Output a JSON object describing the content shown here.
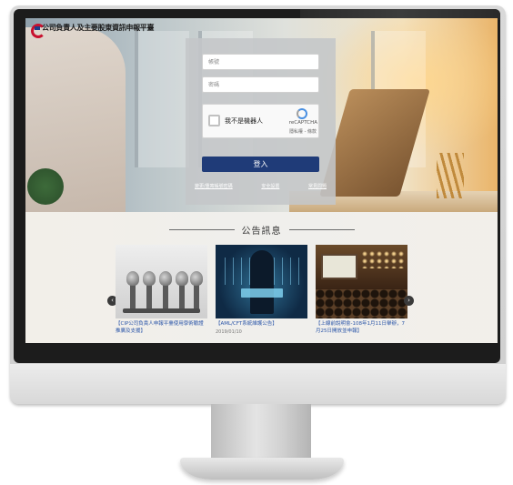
{
  "header": {
    "site_title": "公司負責人及主要股東資訊申報平臺"
  },
  "login": {
    "account_placeholder": "帳號",
    "password_placeholder": "密碼",
    "captcha_label": "我不是機器人",
    "captcha_brand": "reCAPTCHA",
    "captcha_links": "隱私權 - 條款",
    "login_button": "登入",
    "links": [
      "變更/重寄帳號密碼",
      "安全設置",
      "常見問題"
    ]
  },
  "announcements": {
    "title": "公告訊息",
    "items": [
      {
        "title": "【CIP公司負責人申報平臺使用學術驗證推廣及支援】",
        "date": ""
      },
      {
        "title": "【AML/CFT系統維護公告】",
        "date": "2019/01/10"
      },
      {
        "title": "【上線前說明會-108年1月11日舉辦，7月25日開放並申報】",
        "date": ""
      }
    ],
    "prev_arrow": "‹",
    "next_arrow": "›"
  },
  "colors": {
    "login_button": "#1f3b78",
    "announcement_link": "#2a55a8",
    "logo_red": "#c8102e",
    "logo_blue": "#1f3c88"
  }
}
